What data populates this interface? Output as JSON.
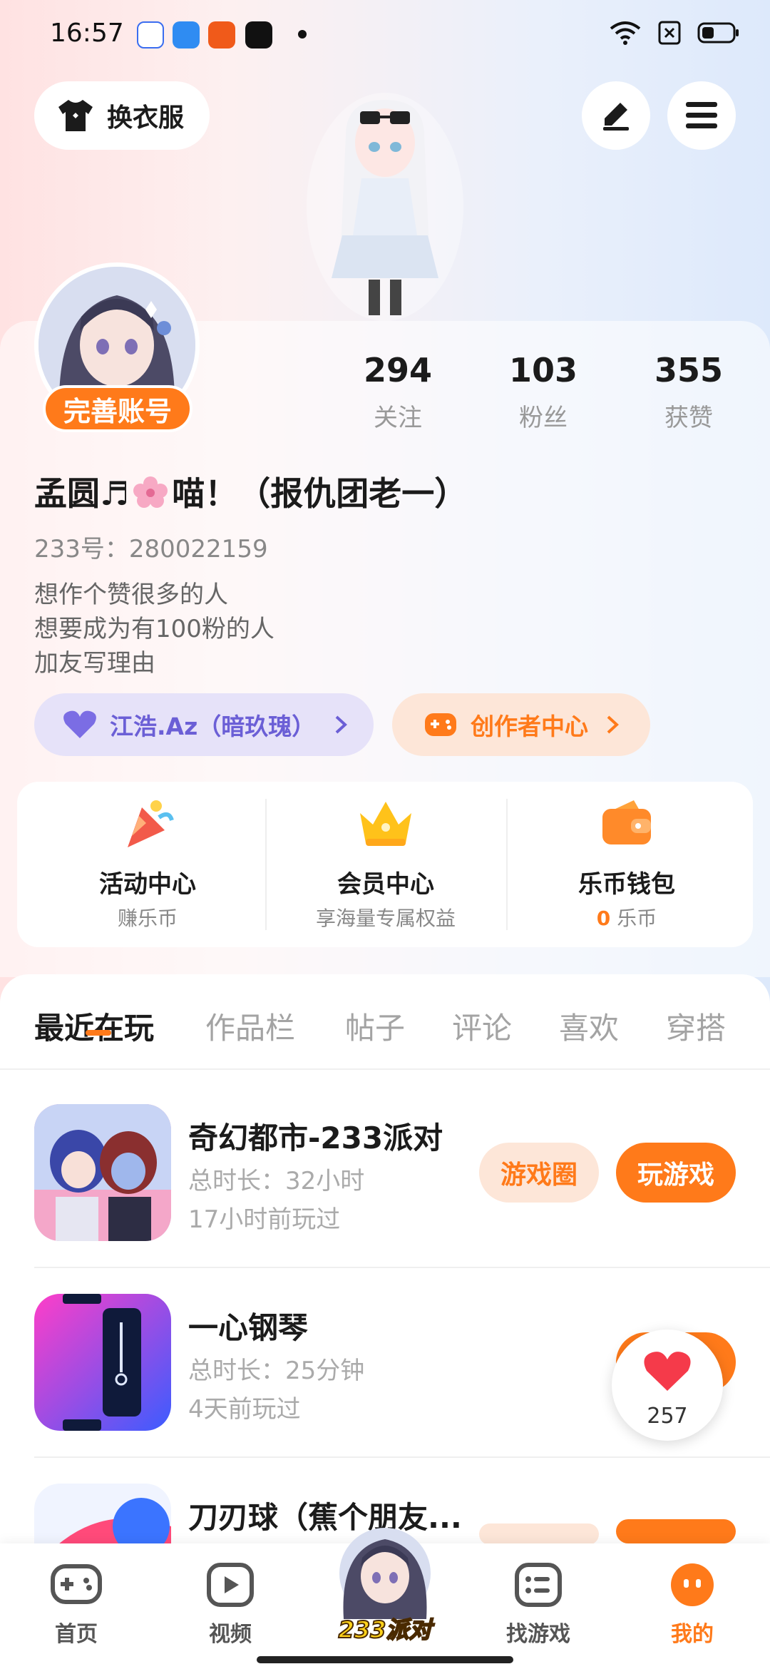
{
  "status_bar": {
    "time": "16:57"
  },
  "header": {
    "change_clothes_label": "换衣服"
  },
  "profile": {
    "complete_account_label": "完善账号",
    "stats": [
      {
        "value": "294",
        "label": "关注"
      },
      {
        "value": "103",
        "label": "粉丝"
      },
      {
        "value": "355",
        "label": "获赞"
      }
    ],
    "nickname_part1": "孟圆♬",
    "nickname_part2": "喵！（报仇团老一）",
    "uid": "233号：280022159",
    "bio": [
      "想作个赞很多的人",
      "想要成为有100粉的人",
      "加友写理由"
    ],
    "partner_tag": "江浩.Az（暗玖瑰）",
    "creator_tag": "创作者中心"
  },
  "quick_links": [
    {
      "title": "活动中心",
      "subtitle": "赚乐币"
    },
    {
      "title": "会员中心",
      "subtitle": "享海量专属权益"
    },
    {
      "title": "乐币钱包",
      "subtitle_number": "0",
      "subtitle_unit": "乐币"
    }
  ],
  "tabs": [
    "最近在玩",
    "作品栏",
    "帖子",
    "评论",
    "喜欢",
    "穿搭"
  ],
  "active_tab": "最近在玩",
  "games": [
    {
      "name": "奇幻都市-233派对",
      "duration": "总时长：32小时",
      "last_played": "17小时前玩过",
      "circle_label": "游戏圈",
      "play_label": "玩游戏"
    },
    {
      "name": "一心钢琴",
      "duration": "总时长：25分钟",
      "last_played": "4天前玩过"
    },
    {
      "name": "刀刃球（蕉个朋友..."
    }
  ],
  "floating_like": {
    "count": "257"
  },
  "bottom_nav": [
    {
      "label": "首页"
    },
    {
      "label": "视频"
    },
    {
      "label": "233派对"
    },
    {
      "label": "找游戏"
    },
    {
      "label": "我的"
    }
  ],
  "colors": {
    "accent": "#ff7a1a",
    "accent_light": "#fde6d8",
    "partner_bg": "#e6e2f9",
    "partner_text": "#6b5fd6"
  }
}
